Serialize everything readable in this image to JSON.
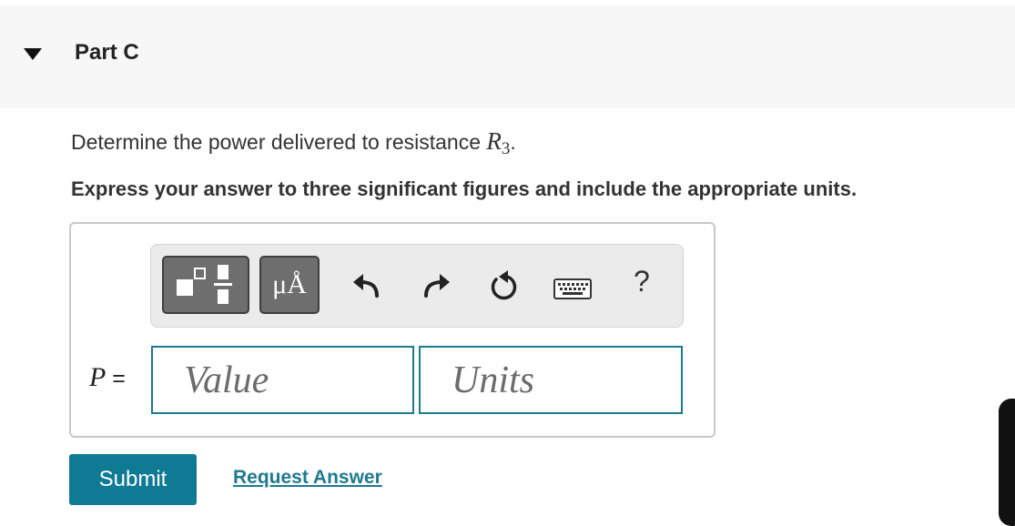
{
  "part": {
    "title": "Part C",
    "icon": "triangle-down-icon"
  },
  "question": {
    "text_before": "Determine the power delivered to resistance ",
    "variable": "R",
    "subscript": "3",
    "text_after": "."
  },
  "instructions": "Express your answer to three significant figures and include the appropriate units.",
  "toolbar": {
    "templates_icon": "templates-icon",
    "units_label": "μÅ",
    "undo_icon": "undo-icon",
    "redo_icon": "redo-icon",
    "reset_icon": "reset-icon",
    "keyboard_icon": "keyboard-icon",
    "help_label": "?"
  },
  "answer": {
    "variable": "P",
    "equals": " =",
    "value_placeholder": "Value",
    "units_placeholder": "Units"
  },
  "actions": {
    "submit_label": "Submit",
    "request_label": "Request Answer"
  },
  "colors": {
    "accent": "#0f7a94",
    "input_border": "#1a7b8e",
    "toolbar_button": "#6e6e6e"
  }
}
